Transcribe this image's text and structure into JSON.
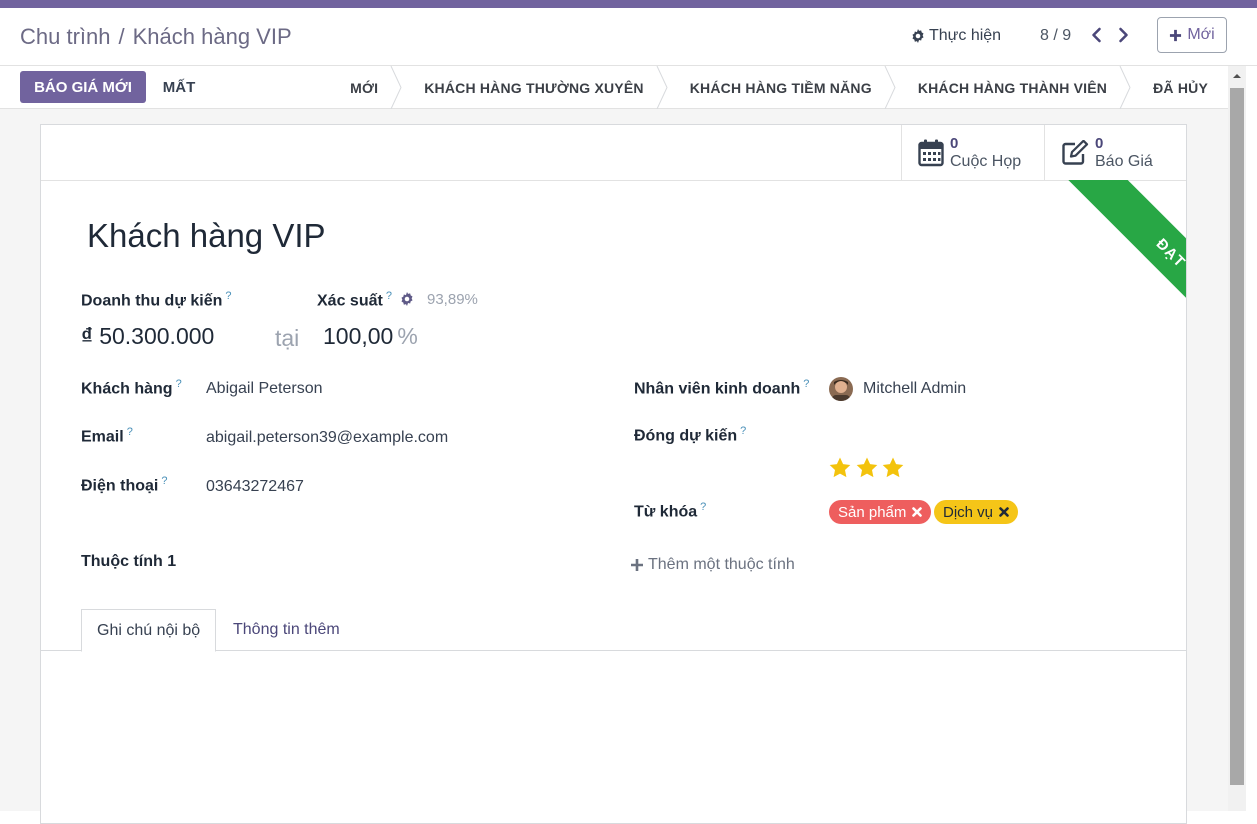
{
  "breadcrumb": {
    "parent": "Chu trình",
    "separator": "/",
    "current": "Khách hàng VIP"
  },
  "action_label": "Thực hiện",
  "pager": {
    "value": "8 / 9"
  },
  "new_button": "Mới",
  "statusbar": {
    "primary_button": "BÁO GIÁ MỚI",
    "lost_button": "MẤT",
    "stages": [
      "MỚI",
      "KHÁCH HÀNG THƯỜNG XUYÊN",
      "KHÁCH HÀNG TIỀM NĂNG",
      "KHÁCH HÀNG THÀNH VIÊN",
      "ĐÃ HỦY"
    ]
  },
  "smart_buttons": {
    "meetings": {
      "count": "0",
      "label": "Cuộc Họp"
    },
    "quotes": {
      "count": "0",
      "label": "Báo Giá"
    }
  },
  "ribbon": "ĐẠT",
  "form": {
    "title": "Khách hàng VIP",
    "revenue_label": "Doanh thu dự kiến",
    "revenue_currency": "₫",
    "revenue_value": "50.300.000",
    "at_label": "tại",
    "probability_label": "Xác suất",
    "probability_auto": "93,89%",
    "probability_value": "100,00",
    "percent_sign": "%",
    "customer_label": "Khách hàng",
    "customer_value": "Abigail Peterson",
    "email_label": "Email",
    "email_value": "abigail.peterson39@example.com",
    "phone_label": "Điện thoại",
    "phone_value": "03643272467",
    "salesperson_label": "Nhân viên kinh doanh",
    "salesperson_value": "Mitchell Admin",
    "close_label": "Đóng dự kiến",
    "priority_stars": 3,
    "tags_label": "Từ khóa",
    "tags": [
      {
        "label": "Sản phẩm",
        "color": "#ee5e5e"
      },
      {
        "label": "Dịch vụ",
        "color": "#f5c518"
      }
    ],
    "property_label": "Thuộc tính 1",
    "add_property": "Thêm một thuộc tính"
  },
  "tabs": [
    "Ghi chú nội bộ",
    "Thông tin thêm"
  ],
  "help_mark": "?",
  "colors": {
    "brand": "#71639e",
    "ribbon": "#28a745",
    "star": "#f3c30d"
  }
}
